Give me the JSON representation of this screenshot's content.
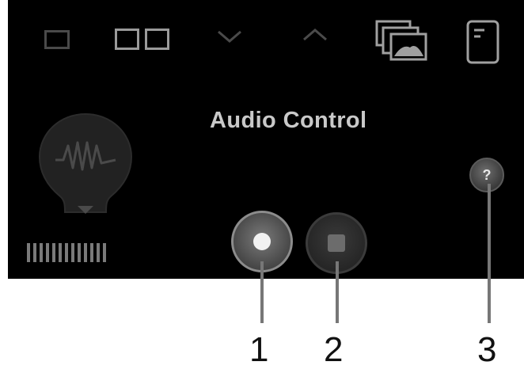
{
  "panel": {
    "title": "Audio Control",
    "help_label": "?"
  },
  "toolbar": {
    "icons": [
      "single-view-icon",
      "dual-view-icon",
      "chevron-down-icon",
      "chevron-up-icon",
      "gallery-icon",
      "document-icon"
    ]
  },
  "controls": {
    "record_icon": "record-icon",
    "stop_icon": "stop-icon"
  },
  "callouts": {
    "one": "1",
    "two": "2",
    "three": "3"
  },
  "level_meter": {
    "bars": 13
  },
  "colors": {
    "background": "#000000",
    "title": "#c9c9c9",
    "icon_dim": "#4a4a4a",
    "icon_light": "#9a9a9a"
  }
}
